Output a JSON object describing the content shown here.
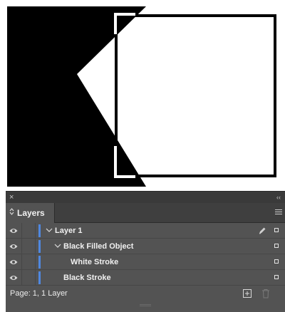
{
  "panel": {
    "tab_title": "Layers",
    "close_glyph": "×",
    "collapse_glyph": "‹‹",
    "tab_glyph": "⌃⌄",
    "layers": [
      {
        "name": "Layer 1",
        "expanded": true,
        "level": 0
      },
      {
        "name": "Black Filled Object",
        "expanded": true,
        "level": 1
      },
      {
        "name": "White Stroke",
        "expanded": false,
        "level": 2
      },
      {
        "name": "Black Stroke",
        "expanded": false,
        "level": 1
      }
    ],
    "status": "Page: 1, 1 Layer"
  },
  "colors": {
    "panel_bg": "#535353",
    "layer_color": "#4f88e0",
    "artwork_fill": "#000000",
    "artwork_stroke": "#000000"
  },
  "icons": [
    "close-icon",
    "collapse-icon",
    "updown-icon",
    "panel-menu-icon",
    "eye-icon",
    "chevron-down-icon",
    "pen-icon",
    "new-layer-icon",
    "trash-icon"
  ]
}
